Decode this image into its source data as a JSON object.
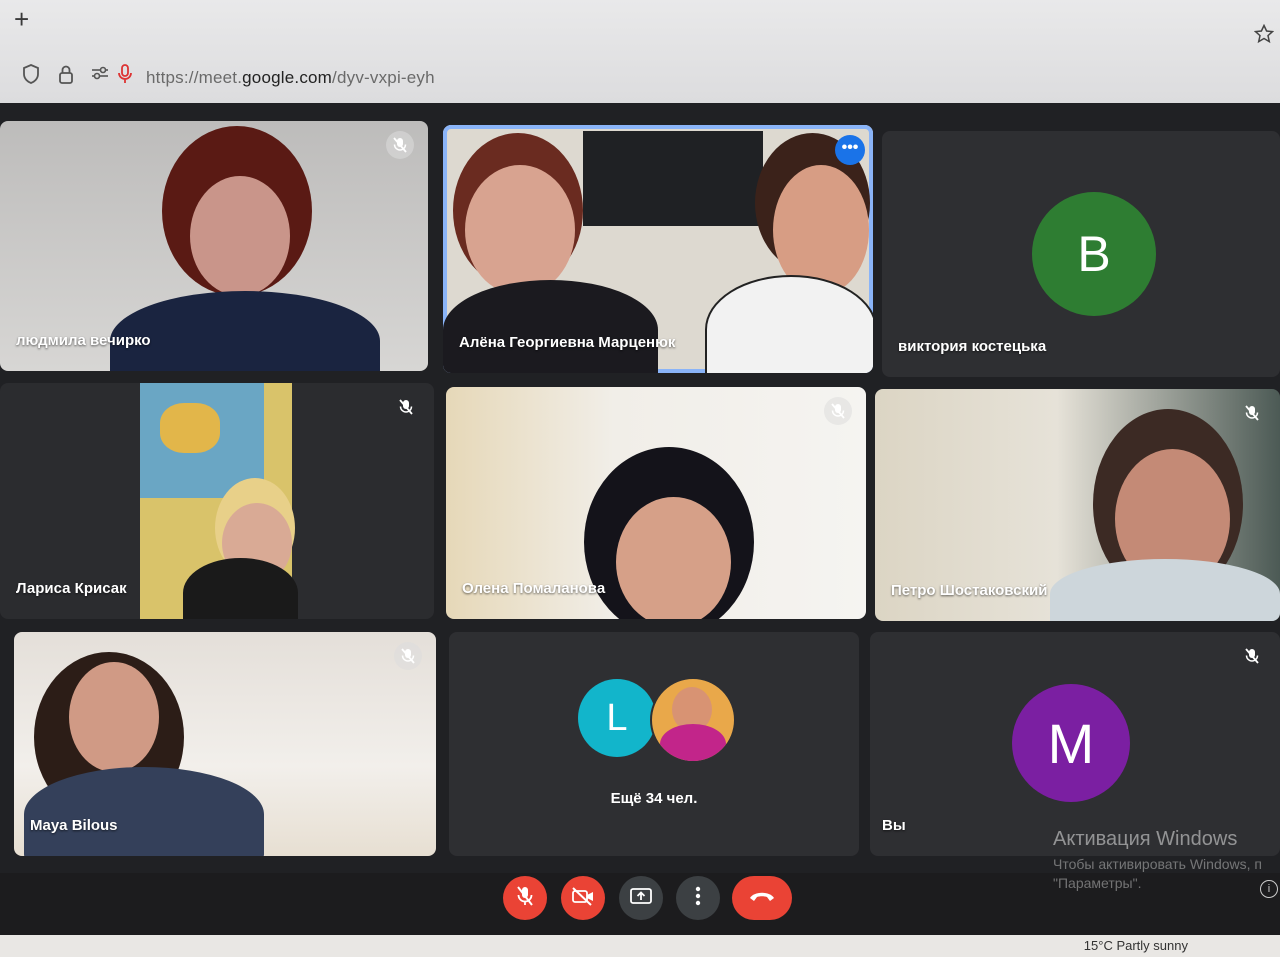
{
  "browser": {
    "new_tab_symbol": "+",
    "url_prefix": "https://meet.",
    "url_domain": "google.com",
    "url_path": "/dyv-vxpi-eyh"
  },
  "tiles": [
    {
      "name": "людмила вечирко",
      "muted": true
    },
    {
      "name": "Алёна Георгиевна Марценюк",
      "muted": false,
      "active": true
    },
    {
      "name": "виктория костецька",
      "avatar_letter": "В",
      "avatar_color": "#2e7d32"
    },
    {
      "name": "Лариса Крисак",
      "muted": true
    },
    {
      "name": "Олена Помаланова",
      "muted": true
    },
    {
      "name": "Петро Шостаковский",
      "muted": true
    },
    {
      "name": "Maya Bilous",
      "muted": true
    },
    {
      "more_letter": "L",
      "more_avatar_color": "#12b5cb",
      "more_label": "Ещё 34 чел."
    },
    {
      "name": "Вы",
      "avatar_letter": "M",
      "avatar_color": "#7b1fa2",
      "muted": true
    }
  ],
  "controls": [
    {
      "id": "mic",
      "icon": "mic-off-icon",
      "color": "#ea4335"
    },
    {
      "id": "camera",
      "icon": "camera-off-icon",
      "color": "#ea4335"
    },
    {
      "id": "present",
      "icon": "present-icon",
      "color": "#3c4043"
    },
    {
      "id": "more",
      "icon": "more-vert-icon",
      "color": "#3c4043"
    },
    {
      "id": "hangup",
      "icon": "hangup-icon",
      "color": "#ea4335"
    }
  ],
  "watermark": {
    "title": "Активация Windows",
    "line1": "Чтобы активировать Windows, п",
    "line2": "\"Параметры\"."
  },
  "taskbar": {
    "weather": "15°C  Partly sunny"
  }
}
